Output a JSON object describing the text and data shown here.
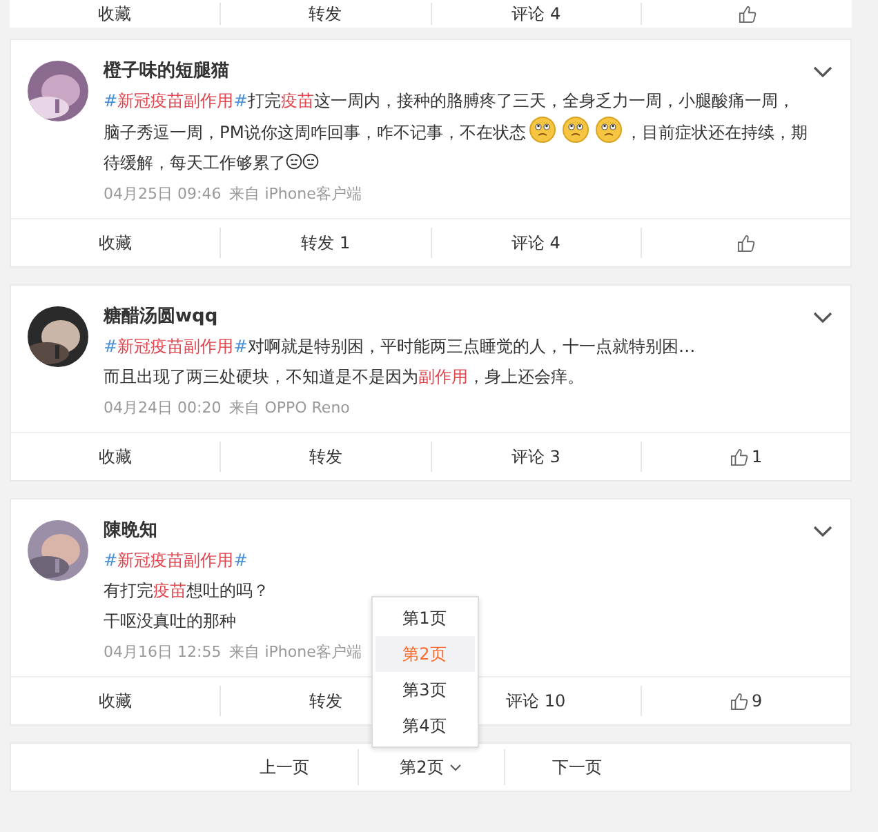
{
  "top_actions": [
    {
      "kind": "text",
      "label": "收藏"
    },
    {
      "kind": "text",
      "label": "转发"
    },
    {
      "kind": "text",
      "label": "评论 4"
    },
    {
      "kind": "like"
    }
  ],
  "posts": [
    {
      "author": "橙子味的短腿猫",
      "lines": [
        [
          {
            "kind": "hash",
            "text": "#"
          },
          {
            "kind": "keyword",
            "text": "新冠疫苗副作用"
          },
          {
            "kind": "hash",
            "text": "#"
          },
          {
            "kind": "text",
            "text": "打完"
          },
          {
            "kind": "keyword",
            "text": "疫苗"
          },
          {
            "kind": "text",
            "text": "这一周内，接种的胳膊疼了三天，全身乏力一周，小腿酸痛一周，脑子秀逗一周，PM说你这周咋回事，咋不记事，不在状态"
          },
          {
            "kind": "emoji"
          },
          {
            "kind": "emoji"
          },
          {
            "kind": "emoji"
          },
          {
            "kind": "text",
            "text": "，目前症状还在持续，期待缓解，每天工作够累了"
          },
          {
            "kind": "emoji-small"
          },
          {
            "kind": "emoji-small"
          }
        ]
      ],
      "time": "04月25日 09:46",
      "source": "来自 iPhone客户端",
      "actions": [
        {
          "kind": "text",
          "label": "收藏"
        },
        {
          "kind": "text",
          "label": "转发 1"
        },
        {
          "kind": "text",
          "label": "评论 4"
        },
        {
          "kind": "like"
        }
      ]
    },
    {
      "author": "糖醋汤圆wqq",
      "lines": [
        [
          {
            "kind": "hash",
            "text": "#"
          },
          {
            "kind": "keyword",
            "text": "新冠疫苗副作用"
          },
          {
            "kind": "hash",
            "text": "#"
          },
          {
            "kind": "text",
            "text": "对啊就是特别困，平时能两三点睡觉的人，十一点就特别困…"
          }
        ],
        [
          {
            "kind": "text",
            "text": "而且出现了两三处硬块，不知道是不是因为"
          },
          {
            "kind": "keyword",
            "text": "副作用"
          },
          {
            "kind": "text",
            "text": "，身上还会痒。"
          }
        ]
      ],
      "time": "04月24日 00:20",
      "source": "来自 OPPO Reno",
      "actions": [
        {
          "kind": "text",
          "label": "收藏"
        },
        {
          "kind": "text",
          "label": "转发"
        },
        {
          "kind": "text",
          "label": "评论 3"
        },
        {
          "kind": "like",
          "label": "1"
        }
      ]
    },
    {
      "author": "陳晩知",
      "lines": [
        [
          {
            "kind": "hash",
            "text": "#"
          },
          {
            "kind": "keyword",
            "text": "新冠疫苗副作用"
          },
          {
            "kind": "hash",
            "text": "#"
          }
        ],
        [
          {
            "kind": "text",
            "text": "有打完"
          },
          {
            "kind": "keyword",
            "text": "疫苗"
          },
          {
            "kind": "text",
            "text": "想吐的吗？"
          }
        ],
        [
          {
            "kind": "text",
            "text": "干呕没真吐的那种"
          }
        ]
      ],
      "time": "04月16日 12:55",
      "source": "来自 iPhone客户端",
      "actions": [
        {
          "kind": "text",
          "label": "收藏"
        },
        {
          "kind": "text",
          "label": "转发"
        },
        {
          "kind": "text",
          "label": "评论 10"
        },
        {
          "kind": "like",
          "label": "9"
        }
      ]
    }
  ],
  "pager": {
    "prev": "上一页",
    "current": "第2页",
    "next": "下一页",
    "menu": [
      {
        "label": "第1页",
        "selected": false
      },
      {
        "label": "第2页",
        "selected": true
      },
      {
        "label": "第3页",
        "selected": false
      },
      {
        "label": "第4页",
        "selected": false
      }
    ]
  }
}
